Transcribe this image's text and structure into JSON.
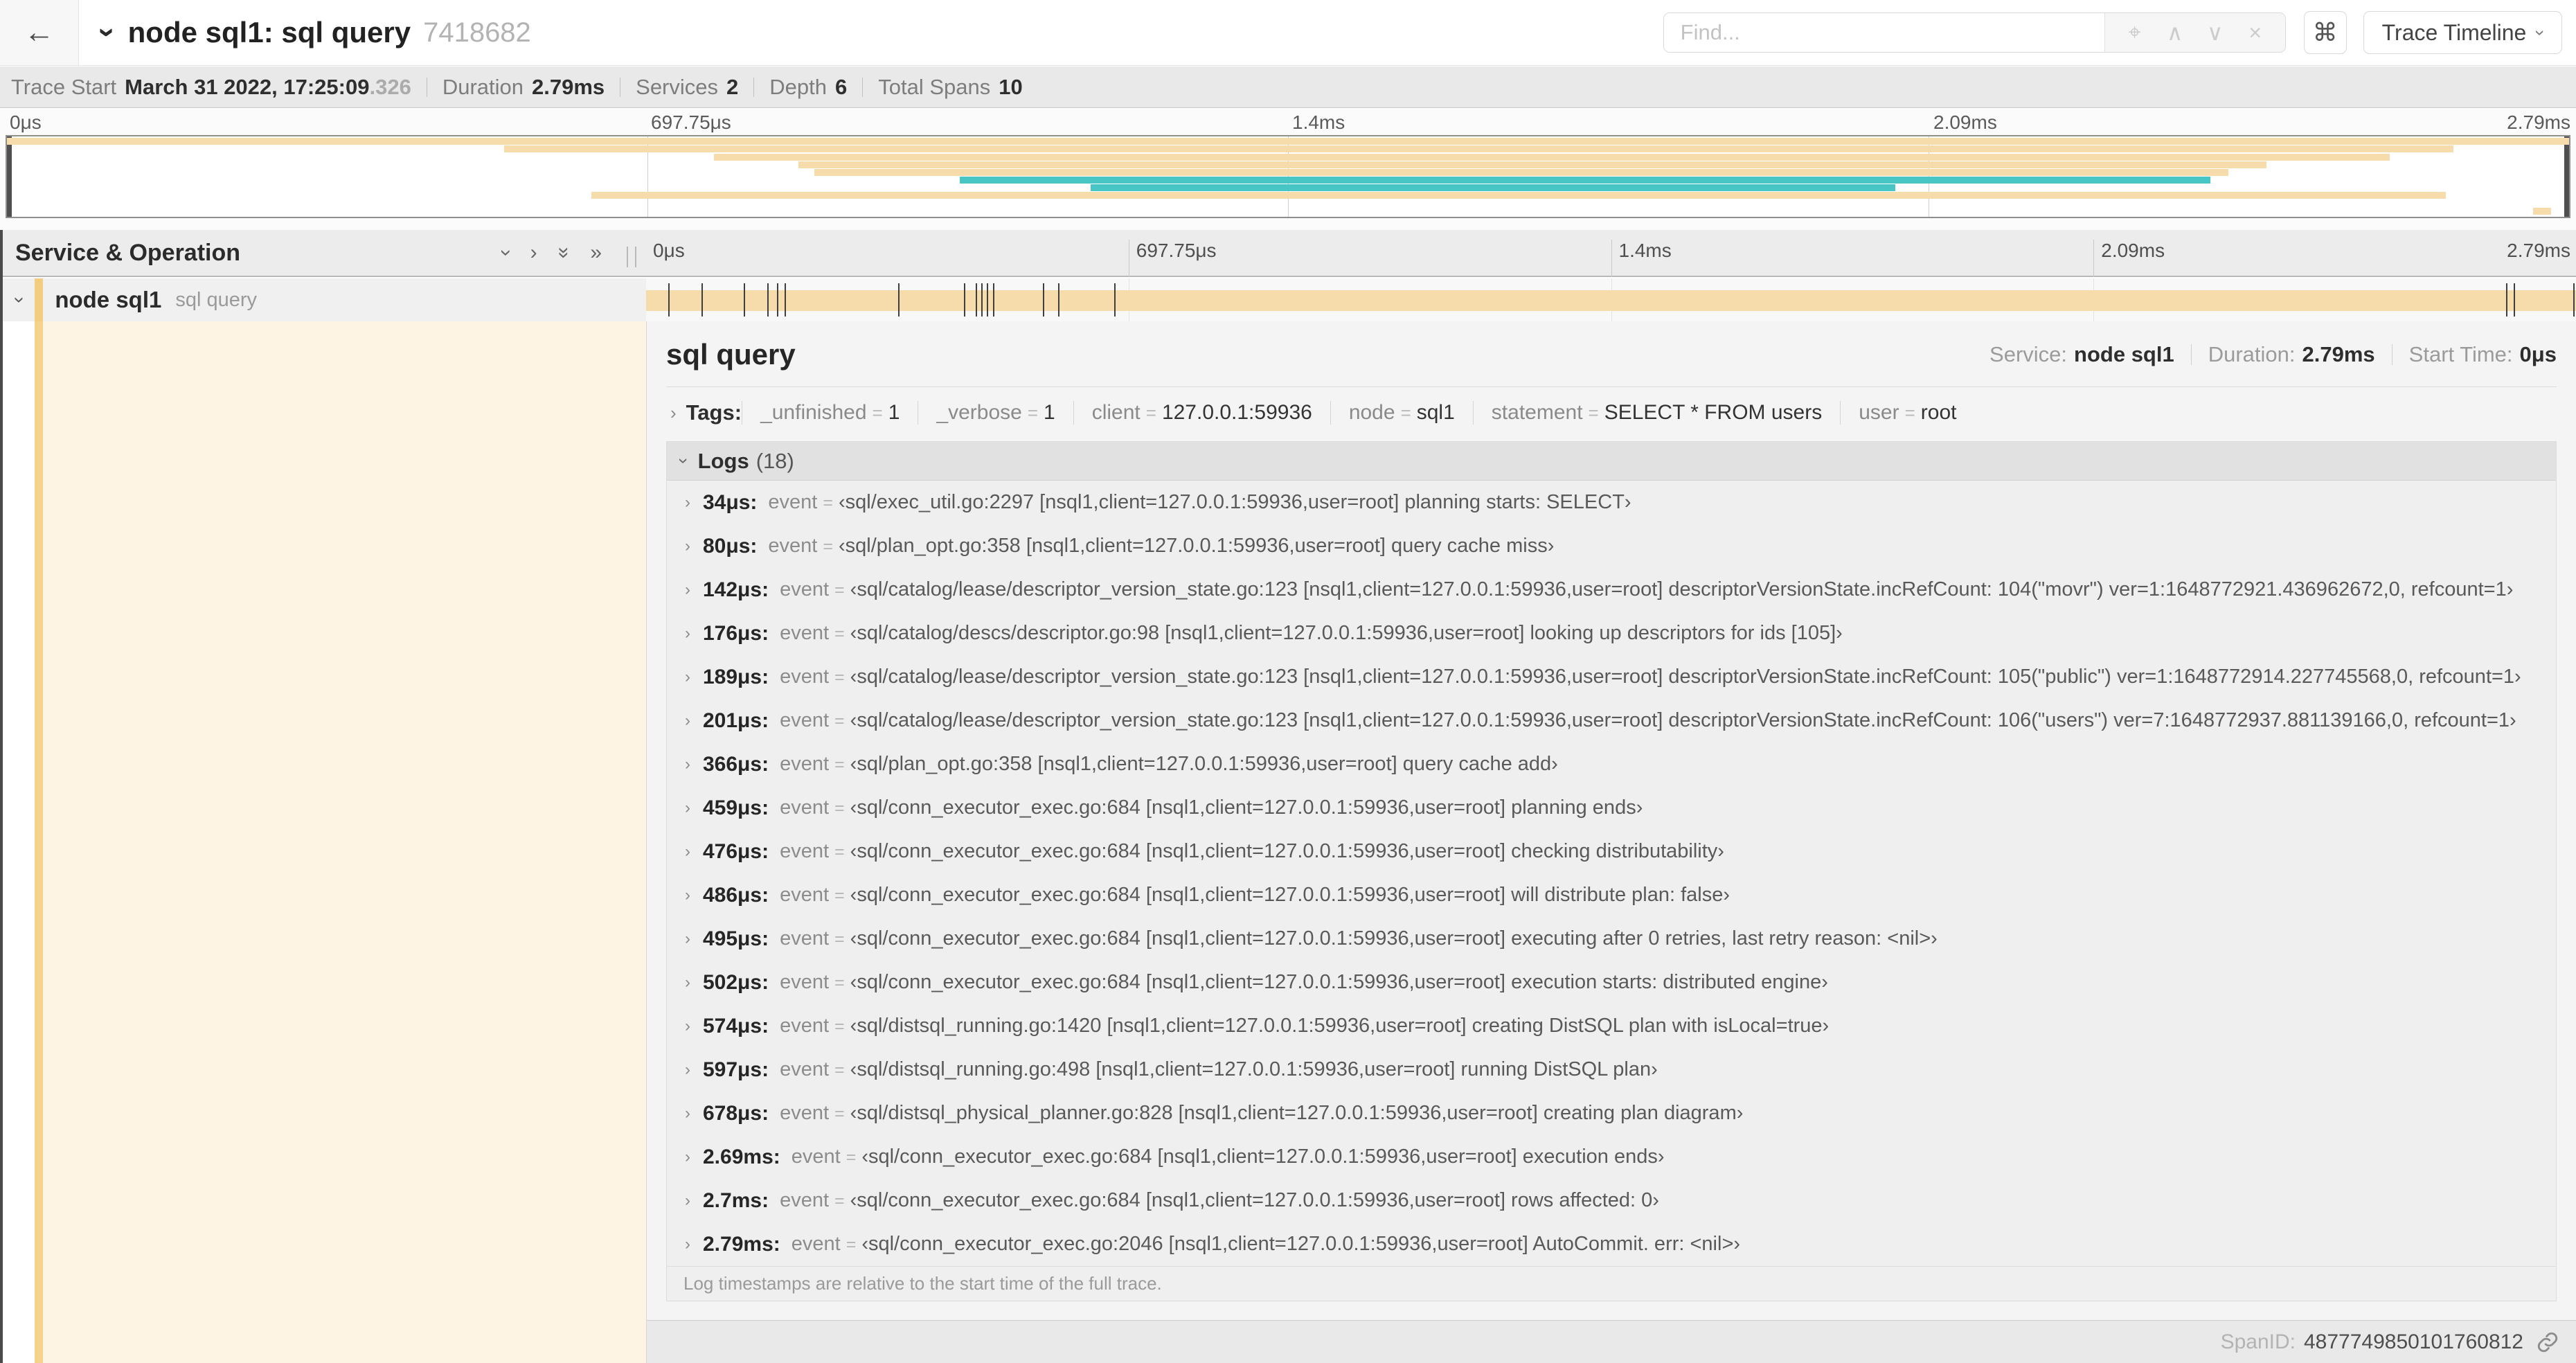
{
  "colors": {
    "tan": "#f7dcab",
    "teal": "#48c5c5",
    "accent": "#f2cd80",
    "accent_soft": "#f5d38c",
    "cream": "#fdf4e3"
  },
  "header": {
    "back_label": "←",
    "title": "node sql1: sql query",
    "trace_id": "7418682",
    "find_placeholder": "Find...",
    "shortcut_key": "⌘",
    "view_selector": "Trace Timeline"
  },
  "summary": {
    "trace_start": {
      "label": "Trace Start",
      "value": "March 31 2022, 17:25:09",
      "fraction": ".326"
    },
    "duration": {
      "label": "Duration",
      "value": "2.79ms"
    },
    "services": {
      "label": "Services",
      "value": "2"
    },
    "depth": {
      "label": "Depth",
      "value": "6"
    },
    "total_spans": {
      "label": "Total Spans",
      "value": "10"
    }
  },
  "overview": {
    "ticks": [
      "0μs",
      "697.75μs",
      "1.4ms",
      "2.09ms",
      "2.79ms"
    ],
    "spans": [
      {
        "start": 0,
        "end": 100,
        "color": "tan"
      },
      {
        "start": 19.4,
        "end": 95.5,
        "color": "tan"
      },
      {
        "start": 27.6,
        "end": 93.0,
        "color": "tan"
      },
      {
        "start": 30.9,
        "end": 88.2,
        "color": "tan"
      },
      {
        "start": 31.5,
        "end": 86.7,
        "color": "tan"
      },
      {
        "start": 37.2,
        "end": 86.0,
        "color": "teal"
      },
      {
        "start": 42.3,
        "end": 73.7,
        "color": "teal"
      },
      {
        "start": 22.8,
        "end": 95.2,
        "color": "tan"
      },
      null,
      {
        "start": 98.6,
        "end": 99.3,
        "color": "tan"
      }
    ]
  },
  "timeline": {
    "left_header": "Service & Operation",
    "ticks": [
      "0μs",
      "697.75μs",
      "1.4ms",
      "2.09ms",
      "2.79ms"
    ],
    "row": {
      "service": "node sql1",
      "operation": "sql query",
      "bar_start": 0,
      "bar_end": 100,
      "event_ticks_pct": [
        1.2,
        2.9,
        5.1,
        6.3,
        6.8,
        7.2,
        13.1,
        16.5,
        17.1,
        17.4,
        17.7,
        18.0,
        20.6,
        21.4,
        24.3,
        96.4,
        96.8,
        99.9
      ]
    }
  },
  "detail": {
    "title": "sql query",
    "meta": [
      {
        "label": "Service:",
        "value": "node sql1"
      },
      {
        "label": "Duration:",
        "value": "2.79ms"
      },
      {
        "label": "Start Time:",
        "value": "0μs"
      }
    ],
    "tags": {
      "label": "Tags:",
      "eq": "=",
      "items": [
        {
          "key": "_unfinished",
          "value": "1"
        },
        {
          "key": "_verbose",
          "value": "1"
        },
        {
          "key": "client",
          "value": "127.0.0.1:59936"
        },
        {
          "key": "node",
          "value": "sql1"
        },
        {
          "key": "statement",
          "value": "SELECT * FROM users"
        },
        {
          "key": "user",
          "value": "root"
        }
      ]
    },
    "logs": {
      "label": "Logs",
      "count": "(18)",
      "field": "event",
      "eq": "=",
      "quote_open": "‹",
      "quote_close": "›",
      "entries": [
        {
          "time": "34μs:",
          "value": "sql/exec_util.go:2297 [nsql1,client=127.0.0.1:59936,user=root] planning starts: SELECT"
        },
        {
          "time": "80μs:",
          "value": "sql/plan_opt.go:358 [nsql1,client=127.0.0.1:59936,user=root] query cache miss"
        },
        {
          "time": "142μs:",
          "value": "sql/catalog/lease/descriptor_version_state.go:123 [nsql1,client=127.0.0.1:59936,user=root] descriptorVersionState.incRefCount: 104(\"movr\") ver=1:1648772921.436962672,0, refcount=1"
        },
        {
          "time": "176μs:",
          "value": "sql/catalog/descs/descriptor.go:98 [nsql1,client=127.0.0.1:59936,user=root] looking up descriptors for ids [105]"
        },
        {
          "time": "189μs:",
          "value": "sql/catalog/lease/descriptor_version_state.go:123 [nsql1,client=127.0.0.1:59936,user=root] descriptorVersionState.incRefCount: 105(\"public\") ver=1:1648772914.227745568,0, refcount=1"
        },
        {
          "time": "201μs:",
          "value": "sql/catalog/lease/descriptor_version_state.go:123 [nsql1,client=127.0.0.1:59936,user=root] descriptorVersionState.incRefCount: 106(\"users\") ver=7:1648772937.881139166,0, refcount=1"
        },
        {
          "time": "366μs:",
          "value": "sql/plan_opt.go:358 [nsql1,client=127.0.0.1:59936,user=root] query cache add"
        },
        {
          "time": "459μs:",
          "value": "sql/conn_executor_exec.go:684 [nsql1,client=127.0.0.1:59936,user=root] planning ends"
        },
        {
          "time": "476μs:",
          "value": "sql/conn_executor_exec.go:684 [nsql1,client=127.0.0.1:59936,user=root] checking distributability"
        },
        {
          "time": "486μs:",
          "value": "sql/conn_executor_exec.go:684 [nsql1,client=127.0.0.1:59936,user=root] will distribute plan: false"
        },
        {
          "time": "495μs:",
          "value": "sql/conn_executor_exec.go:684 [nsql1,client=127.0.0.1:59936,user=root] executing after 0 retries, last retry reason: <nil>"
        },
        {
          "time": "502μs:",
          "value": "sql/conn_executor_exec.go:684 [nsql1,client=127.0.0.1:59936,user=root] execution starts: distributed engine"
        },
        {
          "time": "574μs:",
          "value": "sql/distsql_running.go:1420 [nsql1,client=127.0.0.1:59936,user=root] creating DistSQL plan with isLocal=true"
        },
        {
          "time": "597μs:",
          "value": "sql/distsql_running.go:498 [nsql1,client=127.0.0.1:59936,user=root] running DistSQL plan"
        },
        {
          "time": "678μs:",
          "value": "sql/distsql_physical_planner.go:828 [nsql1,client=127.0.0.1:59936,user=root] creating plan diagram"
        },
        {
          "time": "2.69ms:",
          "value": "sql/conn_executor_exec.go:684 [nsql1,client=127.0.0.1:59936,user=root] execution ends"
        },
        {
          "time": "2.7ms:",
          "value": "sql/conn_executor_exec.go:684 [nsql1,client=127.0.0.1:59936,user=root] rows affected: 0"
        },
        {
          "time": "2.79ms:",
          "value": "sql/conn_executor_exec.go:2046 [nsql1,client=127.0.0.1:59936,user=root] AutoCommit. err: <nil>"
        }
      ]
    },
    "note": "Log timestamps are relative to the start time of the full trace.",
    "footer": {
      "label": "SpanID:",
      "value": "4877749850101760812"
    }
  }
}
